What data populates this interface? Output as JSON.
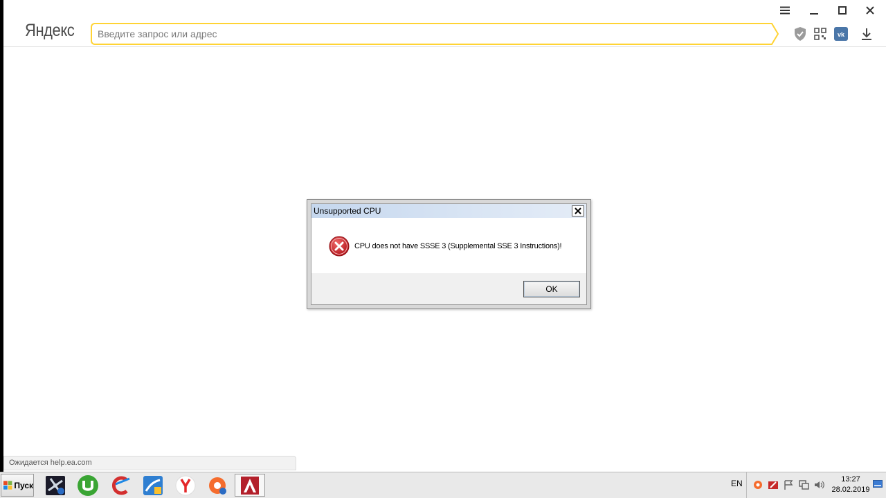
{
  "browser": {
    "logo": "Яндекс",
    "address_placeholder": "Введите запрос или адрес",
    "status_text": "Ожидается help.ea.com"
  },
  "dialog": {
    "title": "Unsupported CPU",
    "message": "CPU does not have SSSE 3 (Supplemental SSE 3 Instructions)!",
    "ok_label": "OK",
    "icon": "error-icon"
  },
  "taskbar": {
    "start_label": "Пуск",
    "apps": [
      "app-icon",
      "utorrent-icon",
      "ccleaner-icon",
      "windows-update-icon",
      "yandex-browser-icon",
      "origin-icon",
      "game-icon"
    ],
    "language": "EN",
    "time": "13:27",
    "date": "28.02.2019"
  },
  "colors": {
    "address_border": "#ffd334",
    "dialog_title_bar": "#c5d7ee",
    "error_red": "#d0232a"
  }
}
